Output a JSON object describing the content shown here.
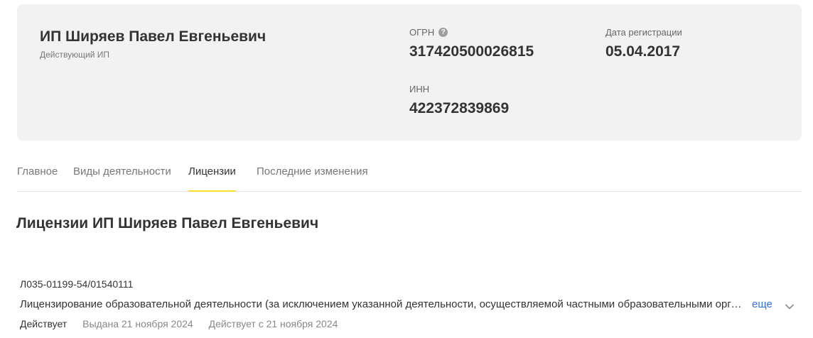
{
  "company": {
    "name": "ИП Ширяев Павел Евгеньевич",
    "status": "Действующий ИП",
    "ogrn_label": "ОГРН",
    "ogrn_value": "317420500026815",
    "reg_date_label": "Дата регистрации",
    "reg_date_value": "05.04.2017",
    "inn_label": "ИНН",
    "inn_value": "422372839869"
  },
  "tabs": [
    {
      "label": "Главное"
    },
    {
      "label": "Виды деятельности"
    },
    {
      "label": "Лицензии",
      "active": true
    },
    {
      "label": "Последние изменения"
    }
  ],
  "section": {
    "title": "Лицензии ИП Ширяев Павел Евгеньевич"
  },
  "license": {
    "number": "Л035-01199-54/01540111",
    "description": "Лицензирование образовательной деятельности (за исключением указанной деятельности, осуществляемой частными образовательными организациями на территории инновационного научно-технологического центра)",
    "more_label": "еще",
    "status": "Действует",
    "issued": "Выдана 21 ноября 2024",
    "valid_from": "Действует с 21 ноября 2024"
  },
  "icons": {
    "help": "question-circle-icon",
    "expand": "chevron-down-icon"
  },
  "colors": {
    "active_tab_underline": "#ffdd2d",
    "link": "#336fee"
  }
}
